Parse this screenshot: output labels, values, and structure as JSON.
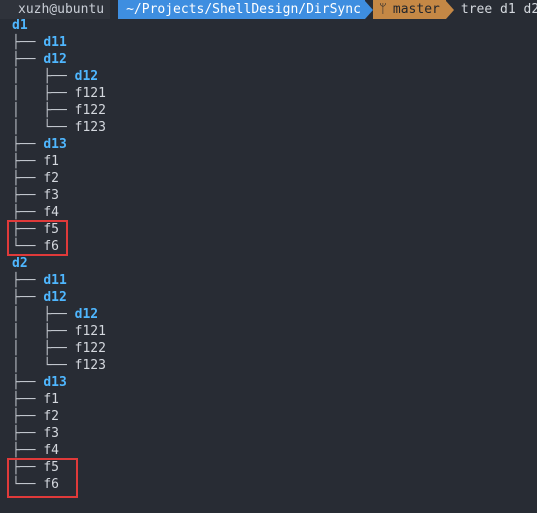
{
  "prompt": {
    "user": "xuzh@ubuntu",
    "path": "~/Projects/ShellDesign/DirSync",
    "branch_icon": "git-branch-icon",
    "branch": "master",
    "command": "tree d1 d2"
  },
  "trees": [
    {
      "root": "d1",
      "lines": [
        {
          "prefix": "├── ",
          "name": "d11",
          "type": "dir"
        },
        {
          "prefix": "├── ",
          "name": "d12",
          "type": "dir"
        },
        {
          "prefix": "│   ├── ",
          "name": "d12",
          "type": "dir"
        },
        {
          "prefix": "│   ├── ",
          "name": "f121",
          "type": "file"
        },
        {
          "prefix": "│   ├── ",
          "name": "f122",
          "type": "file"
        },
        {
          "prefix": "│   └── ",
          "name": "f123",
          "type": "file"
        },
        {
          "prefix": "├── ",
          "name": "d13",
          "type": "dir"
        },
        {
          "prefix": "├── ",
          "name": "f1",
          "type": "file"
        },
        {
          "prefix": "├── ",
          "name": "f2",
          "type": "file"
        },
        {
          "prefix": "├── ",
          "name": "f3",
          "type": "file"
        },
        {
          "prefix": "├── ",
          "name": "f4",
          "type": "file"
        },
        {
          "prefix": "├── ",
          "name": "f5",
          "type": "file"
        },
        {
          "prefix": "└── ",
          "name": "f6",
          "type": "file"
        }
      ]
    },
    {
      "root": "d2",
      "lines": [
        {
          "prefix": "├── ",
          "name": "d11",
          "type": "dir"
        },
        {
          "prefix": "├── ",
          "name": "d12",
          "type": "dir"
        },
        {
          "prefix": "│   ├── ",
          "name": "d12",
          "type": "dir"
        },
        {
          "prefix": "│   ├── ",
          "name": "f121",
          "type": "file"
        },
        {
          "prefix": "│   ├── ",
          "name": "f122",
          "type": "file"
        },
        {
          "prefix": "│   └── ",
          "name": "f123",
          "type": "file"
        },
        {
          "prefix": "├── ",
          "name": "d13",
          "type": "dir"
        },
        {
          "prefix": "├── ",
          "name": "f1",
          "type": "file"
        },
        {
          "prefix": "├── ",
          "name": "f2",
          "type": "file"
        },
        {
          "prefix": "├── ",
          "name": "f3",
          "type": "file"
        },
        {
          "prefix": "├── ",
          "name": "f4",
          "type": "file"
        },
        {
          "prefix": "├── ",
          "name": "f5",
          "type": "file"
        },
        {
          "prefix": "└── ",
          "name": "f6",
          "type": "file"
        }
      ]
    }
  ],
  "colors": {
    "background": "#282c34",
    "directory": "#4fb7ff",
    "file": "#d4d8de",
    "path_segment": "#3e8ee0",
    "git_segment": "#c58845",
    "highlight_box": "#e03a3a"
  }
}
